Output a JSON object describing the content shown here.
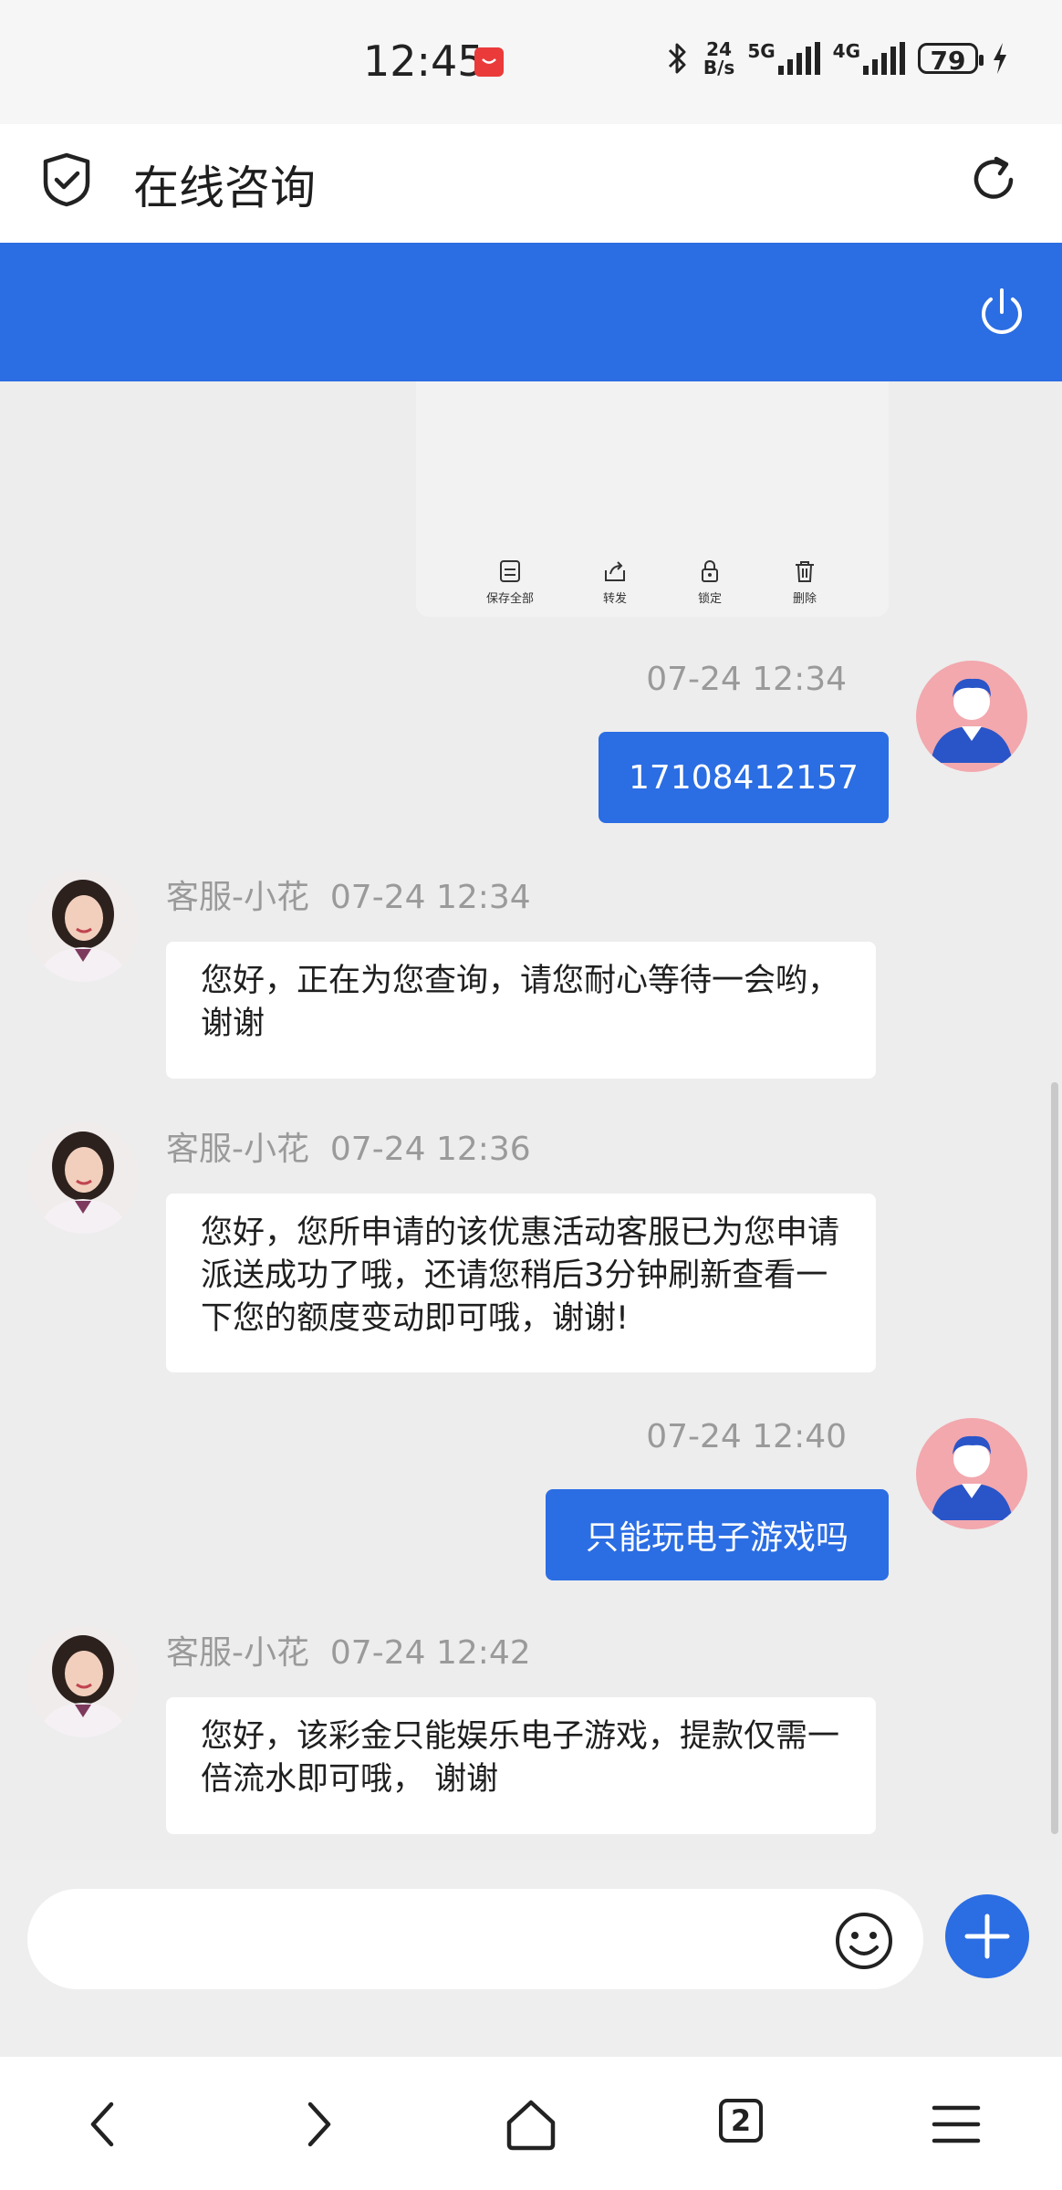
{
  "status_bar": {
    "time": "12:45",
    "network_speed_value": "24",
    "network_speed_unit": "B/s",
    "network_5g": "5G",
    "network_4g": "4G",
    "battery": "79"
  },
  "header": {
    "title": "在线咨询"
  },
  "image_toolbar": {
    "items": [
      {
        "label": "保存全部",
        "icon": "save-icon"
      },
      {
        "label": "转发",
        "icon": "share-icon"
      },
      {
        "label": "锁定",
        "icon": "lock-icon"
      },
      {
        "label": "删除",
        "icon": "trash-icon"
      }
    ]
  },
  "messages": [
    {
      "side": "out",
      "time": "07-24 12:34",
      "text": "17108412157"
    },
    {
      "side": "in",
      "sender": "客服-小花",
      "time": "07-24 12:34",
      "text": "您好，正在为您查询，请您耐心等待一会哟，谢谢"
    },
    {
      "side": "in",
      "sender": "客服-小花",
      "time": "07-24 12:36",
      "text": "您好，您所申请的该优惠活动客服已为您申请派送成功了哦，还请您稍后3分钟刷新查看一下您的额度变动即可哦，谢谢!"
    },
    {
      "side": "out",
      "time": "07-24 12:40",
      "text": "只能玩电子游戏吗"
    },
    {
      "side": "in",
      "sender": "客服-小花",
      "time": "07-24 12:42",
      "text": "您好，该彩金只能娱乐电子游戏，提款仅需一倍流水即可哦， 谢谢"
    }
  ],
  "input": {
    "placeholder": ""
  },
  "nav": {
    "tab_count": "2"
  },
  "colors": {
    "accent": "#2b6de3",
    "background": "#ededed"
  }
}
